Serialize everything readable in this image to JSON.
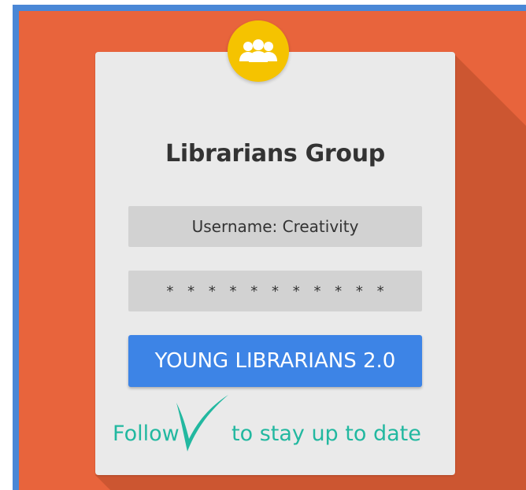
{
  "card": {
    "title": "Librarians Group",
    "username_field": "Username: Creativity",
    "password_field": "* * * * * * * * * * *",
    "button_label": "YOUNG LIBRARIANS 2.0"
  },
  "footer": {
    "follow_prefix": "Follow",
    "follow_suffix": "to stay up to date"
  },
  "icons": {
    "group": "group-icon",
    "check": "checkmark-icon"
  },
  "colors": {
    "background": "#e8643c",
    "border": "#4a87d6",
    "card": "#eaeaea",
    "badge": "#f5c300",
    "button": "#3d84e6",
    "accent_text": "#22b8a0"
  }
}
